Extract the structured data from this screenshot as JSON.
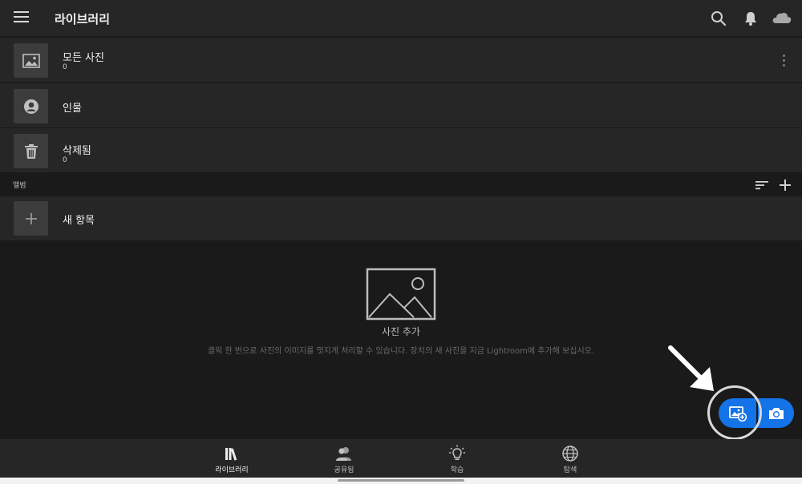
{
  "header": {
    "title": "라이브러리",
    "icons": [
      "menu-icon",
      "search-icon",
      "bell-icon",
      "cloud-icon"
    ]
  },
  "library_items": [
    {
      "title": "모든 사진",
      "count": "0",
      "icon": "image-icon"
    },
    {
      "title": "인물",
      "icon": "person-icon"
    },
    {
      "title": "삭제됨",
      "count": "0",
      "icon": "trash-icon"
    }
  ],
  "albums": {
    "section_label": "앨범",
    "new_item_label": "새 항목"
  },
  "empty_state": {
    "title": "사진 추가",
    "description": "클릭 한 번으로 사진의 이미지를 멋지게 처리할 수 있습니다. 장치의 새 사진을 지금 Lightroom에 추가해 보십시오."
  },
  "bottom_nav": [
    {
      "label": "라이브러리",
      "icon": "library-icon",
      "active": true
    },
    {
      "label": "공유됨",
      "icon": "people-icon"
    },
    {
      "label": "학습",
      "icon": "lightbulb-icon"
    },
    {
      "label": "탐색",
      "icon": "globe-icon"
    }
  ],
  "colors": {
    "accent": "#1473e6",
    "background": "#1a1a1a",
    "panel": "#262626"
  }
}
